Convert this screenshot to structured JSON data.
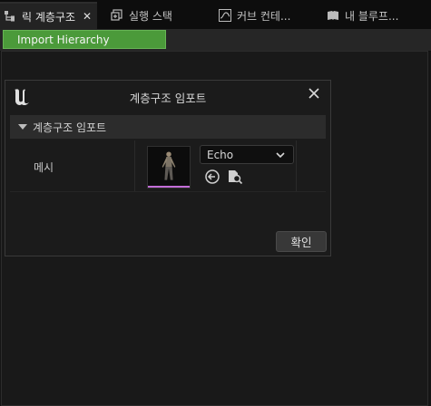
{
  "tabs": [
    {
      "label": "릭 계층구조",
      "icon": "hierarchy-icon",
      "active": true
    },
    {
      "label": "실행 스택",
      "icon": "stack-icon",
      "active": false
    },
    {
      "label": "커브 컨테...",
      "icon": "curve-icon",
      "active": false
    },
    {
      "label": "내 블루프...",
      "icon": "book-icon",
      "active": false
    }
  ],
  "toolbar": {
    "import_label": "Import Hierarchy"
  },
  "dialog": {
    "title": "계층구조 임포트",
    "section_title": "계층구조 임포트",
    "mesh_label": "메시",
    "mesh_value": "Echo",
    "ok_label": "확인"
  },
  "colors": {
    "accent_green": "#4b9a3a",
    "thumb_underline": "#c36ed8"
  }
}
